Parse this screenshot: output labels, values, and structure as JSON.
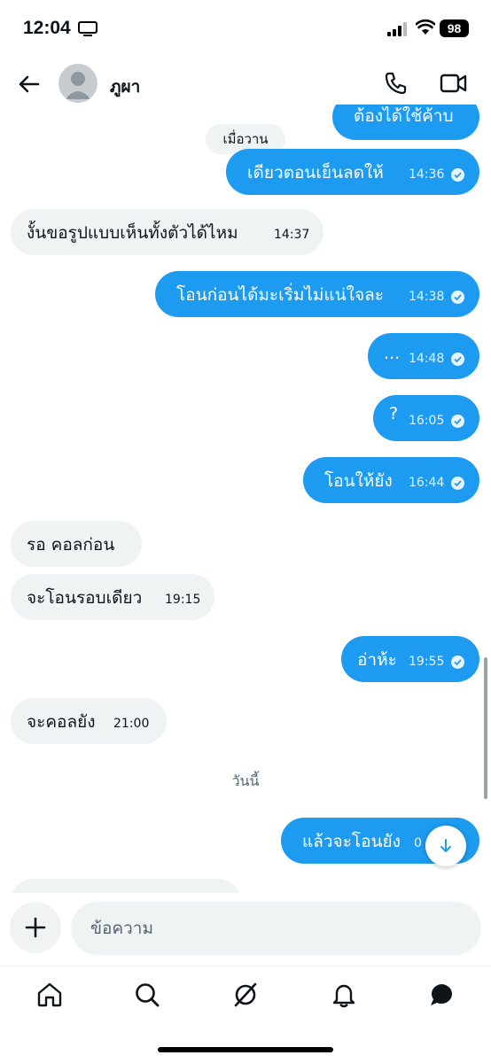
{
  "status_bar": {
    "time": "12:04",
    "battery": "98"
  },
  "header": {
    "contact_name": "ภูผา"
  },
  "chat": {
    "partial_top_message": "ต้องได้ใช้ค้าบ",
    "day_separator_yesterday": "เมื่อวาน",
    "day_separator_today": "วันนี้",
    "messages": [
      {
        "direction": "out",
        "text": "เดียวตอนเย็นลดให้",
        "time": "14:36"
      },
      {
        "direction": "in",
        "text": "งั้นขอรูปแบบเห็นทั้งตัวได้ไหม",
        "time": "14:37"
      },
      {
        "direction": "out",
        "text": "โอนก่อนได้มะเริ่มไม่แน่ใจละ",
        "time": "14:38"
      },
      {
        "direction": "out",
        "text": "...",
        "time": "14:48"
      },
      {
        "direction": "out",
        "text": "?",
        "time": "16:05"
      },
      {
        "direction": "out",
        "text": "โอนให้ยัง",
        "time": "16:44"
      },
      {
        "direction": "in",
        "text": "รอ คอลก่อน",
        "time": ""
      },
      {
        "direction": "in",
        "text": "จะโอนรอบเดียว",
        "time": "19:15"
      },
      {
        "direction": "out",
        "text": "อ่าห้ะ",
        "time": "19:55"
      },
      {
        "direction": "in",
        "text": "จะคอลยัง",
        "time": "21:00"
      },
      {
        "direction": "out",
        "text": "แล้วจะโอนยัง",
        "time": "0"
      }
    ]
  },
  "composer": {
    "placeholder": "ข้อความ"
  },
  "tabbar": {
    "items": [
      "home-icon",
      "search-icon",
      "grok-icon",
      "notifications-icon",
      "messages-icon"
    ]
  },
  "colors": {
    "accent": "#1d9bf0",
    "incoming_bubble": "#eff3f4"
  }
}
